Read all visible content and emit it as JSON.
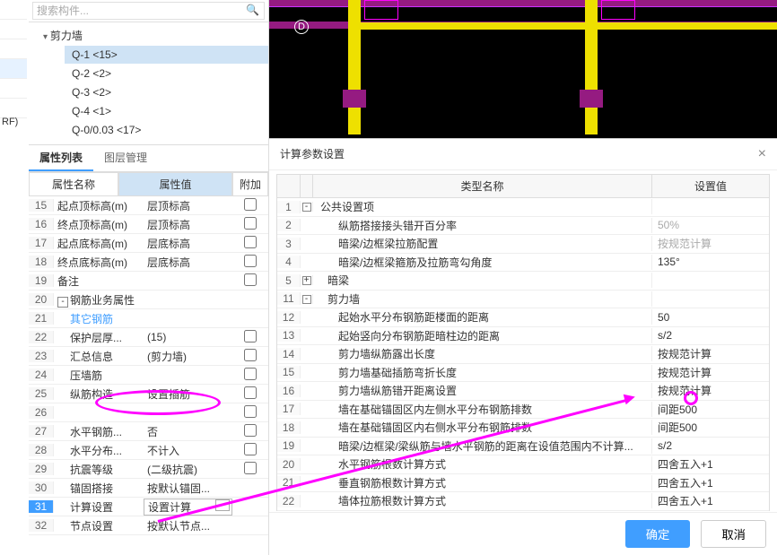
{
  "search": {
    "placeholder": "搜索构件...",
    "icon_name": "search-icon"
  },
  "tree": {
    "root": "剪力墙",
    "items": [
      {
        "label": "Q-1 <15>",
        "selected": true
      },
      {
        "label": "Q-2 <2>"
      },
      {
        "label": "Q-3 <2>"
      },
      {
        "label": "Q-4 <1>"
      },
      {
        "label": "Q-0/0.03 <17>"
      }
    ]
  },
  "side_label": "​RF)",
  "tabs": {
    "properties": "属性列表",
    "layers": "图层管理"
  },
  "prop_header": {
    "name": "属性名称",
    "value": "属性值",
    "extra": "附加"
  },
  "prop_rows": [
    {
      "n": 15,
      "name": "起点顶标高(m)",
      "val": "层顶标高",
      "cb": true
    },
    {
      "n": 16,
      "name": "终点顶标高(m)",
      "val": "层顶标高",
      "cb": true
    },
    {
      "n": 17,
      "name": "起点底标高(m)",
      "val": "层底标高",
      "cb": true
    },
    {
      "n": 18,
      "name": "终点底标高(m)",
      "val": "层底标高",
      "cb": true
    },
    {
      "n": 19,
      "name": "备注",
      "val": "",
      "cb": true
    },
    {
      "n": 20,
      "name": "钢筋业务属性",
      "val": "",
      "group": true
    },
    {
      "n": 21,
      "name": "其它钢筋",
      "val": "",
      "indent": 1,
      "link": true
    },
    {
      "n": 22,
      "name": "保护层厚...",
      "val": "(15)",
      "indent": 1,
      "cb": true
    },
    {
      "n": 23,
      "name": "汇总信息",
      "val": "(剪力墙)",
      "indent": 1,
      "cb": true
    },
    {
      "n": 24,
      "name": "压墙筋",
      "val": "",
      "indent": 1,
      "cb": true
    },
    {
      "n": 25,
      "name": "纵筋构造",
      "val": "设置插筋",
      "indent": 1,
      "cb": true
    },
    {
      "n": 26,
      "name": "",
      "val": "",
      "indent": 1,
      "cb": true
    },
    {
      "n": 27,
      "name": "水平钢筋...",
      "val": "否",
      "indent": 1,
      "cb": true
    },
    {
      "n": 28,
      "name": "水平分布...",
      "val": "不计入",
      "indent": 1,
      "cb": true
    },
    {
      "n": 29,
      "name": "抗震等级",
      "val": "(二级抗震)",
      "indent": 1,
      "cb": true
    },
    {
      "n": 30,
      "name": "锚固搭接",
      "val": "按默认锚固...",
      "indent": 1
    },
    {
      "n": 31,
      "name": "计算设置",
      "val": "设置计算",
      "indent": 1,
      "selected": true,
      "editable": true
    },
    {
      "n": 32,
      "name": "节点设置",
      "val": "按默认节点...",
      "indent": 1
    }
  ],
  "canvas": {
    "label_D": "D"
  },
  "dialog": {
    "title": "计算参数设置",
    "header": {
      "type": "类型名称",
      "value": "设置值"
    },
    "rows": [
      {
        "n": 1,
        "name": "公共设置项",
        "val": "",
        "group": "-"
      },
      {
        "n": 2,
        "name": "纵筋搭接接头错开百分率",
        "val": "50%",
        "indent": 1,
        "dim": true
      },
      {
        "n": 3,
        "name": "暗梁/边框梁拉筋配置",
        "val": "按规范计算",
        "indent": 1,
        "dim": true
      },
      {
        "n": 4,
        "name": "暗梁/边框梁箍筋及拉筋弯勾角度",
        "val": "135°",
        "indent": 1
      },
      {
        "n": 5,
        "name": "暗梁",
        "val": "",
        "group": "+",
        "indent": 2
      },
      {
        "n": 11,
        "name": "剪力墙",
        "val": "",
        "group": "-",
        "indent": 2
      },
      {
        "n": 12,
        "name": "起始水平分布钢筋距楼面的距离",
        "val": "50",
        "indent": 1
      },
      {
        "n": 13,
        "name": "起始竖向分布钢筋距暗柱边的距离",
        "val": "s/2",
        "indent": 1
      },
      {
        "n": 14,
        "name": "剪力墙纵筋露出长度",
        "val": "按规范计算",
        "indent": 1
      },
      {
        "n": 15,
        "name": "剪力墙基础插筋弯折长度",
        "val": "按规范计算",
        "indent": 1
      },
      {
        "n": 16,
        "name": "剪力墙纵筋错开距离设置",
        "val": "按规范计算",
        "indent": 1
      },
      {
        "n": 17,
        "name": "墙在基础锚固区内左侧水平分布钢筋排数",
        "val": "间距500",
        "indent": 1
      },
      {
        "n": 18,
        "name": "墙在基础锚固区内右侧水平分布钢筋排数",
        "val": "间距500",
        "indent": 1
      },
      {
        "n": 19,
        "name": "暗梁/边框梁/梁纵筋与墙水平钢筋的距离在设值范围内不计算...",
        "val": "s/2",
        "indent": 1
      },
      {
        "n": 20,
        "name": "水平钢筋根数计算方式",
        "val": "四舍五入+1",
        "indent": 1
      },
      {
        "n": 21,
        "name": "垂直钢筋根数计算方式",
        "val": "四舍五入+1",
        "indent": 1
      },
      {
        "n": 22,
        "name": "墙体拉筋根数计算方式",
        "val": "四舍五入+1",
        "indent": 1
      }
    ],
    "ok": "确定",
    "cancel": "取消"
  },
  "colors": {
    "accent": "#409eff",
    "magenta": "#ff00ff"
  }
}
